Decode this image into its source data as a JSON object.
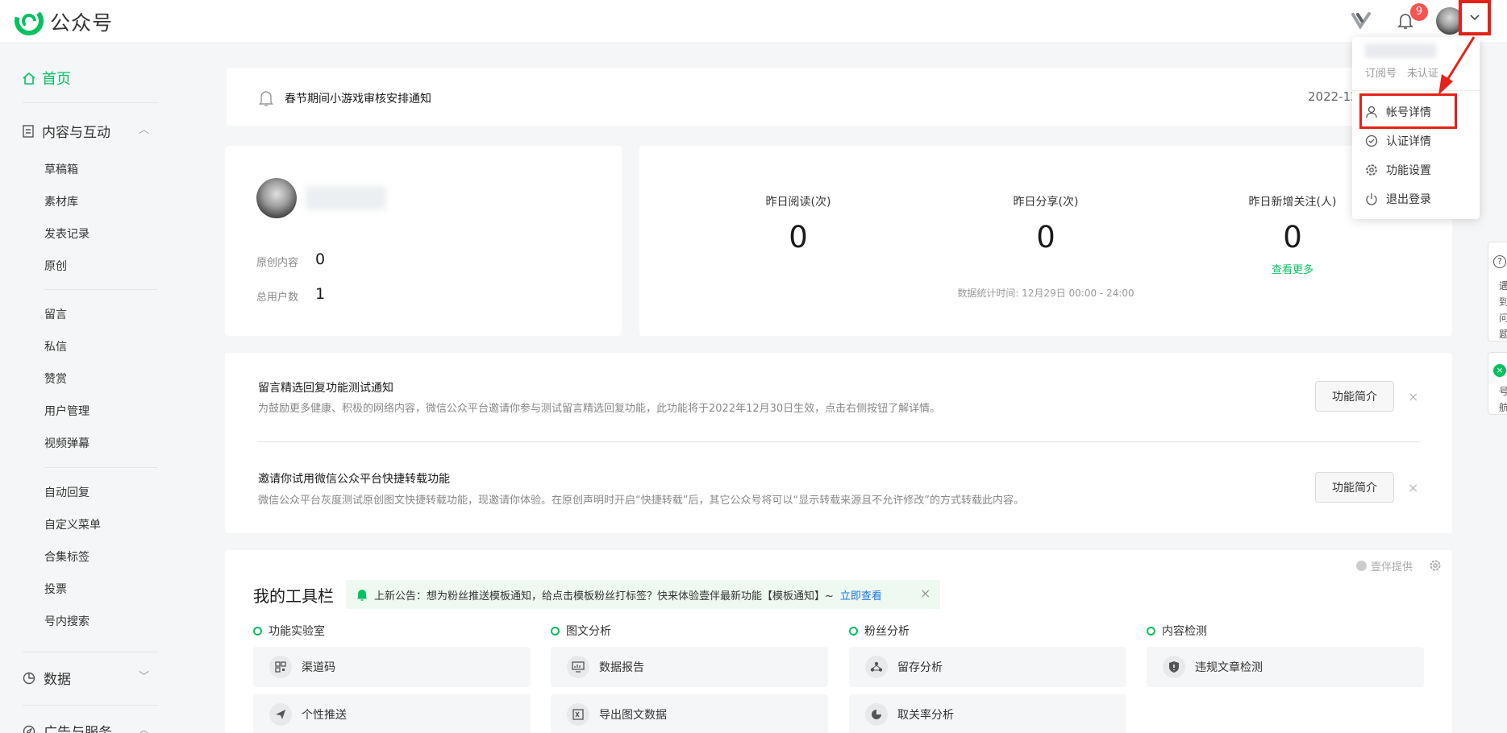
{
  "header": {
    "brand": "公众号",
    "notification_count": "9"
  },
  "sidebar": {
    "home": "首页",
    "content_section": "内容与互动",
    "content_items": [
      "草稿箱",
      "素材库",
      "发表记录",
      "原创"
    ],
    "interaction_items": [
      "留言",
      "私信",
      "赞赏",
      "用户管理",
      "视频弹幕"
    ],
    "tool_items": [
      "自动回复",
      "自定义菜单",
      "合集标签",
      "投票",
      "号内搜索"
    ],
    "data_section": "数据",
    "ads_section": "广告与服务"
  },
  "notice": {
    "text": "春节期间小游戏审核安排通知",
    "date": "2022-12"
  },
  "profile": {
    "original_label": "原创内容",
    "original_value": "0",
    "users_label": "总用户数",
    "users_value": "1"
  },
  "stats": {
    "items": [
      {
        "label": "昨日阅读(次)",
        "value": "0"
      },
      {
        "label": "昨日分享(次)",
        "value": "0"
      },
      {
        "label": "昨日新增关注(人)",
        "value": "0"
      }
    ],
    "more_link": "查看更多",
    "stat_time": "数据统计时间: 12月29日 00:00 - 24:00"
  },
  "notices": [
    {
      "title": "留言精选回复功能测试通知",
      "desc": "为鼓励更多健康、积极的网络内容，微信公众平台邀请你参与测试留言精选回复功能，此功能将于2022年12月30日生效，点击右侧按钮了解详情。",
      "button": "功能简介",
      "close": "×"
    },
    {
      "title": "邀请你试用微信公众平台快捷转载功能",
      "desc": "微信公众平台灰度测试原创图文快捷转载功能，现邀请你体验。在原创声明时开启“快捷转载”后，其它公众号将可以“显示转载来源且不允许修改”的方式转载此内容。",
      "button": "功能简介",
      "close": "×"
    }
  ],
  "toolbar": {
    "title": "我的工具栏",
    "provider": "壹伴提供",
    "announcement": "上新公告：想为粉丝推送模板通知，给点击模板粉丝打标签？快来体验壹伴最新功能【模板通知】~",
    "announcement_link": "立即查看",
    "announcement_close": "×",
    "categories": [
      {
        "name": "功能实验室",
        "tools": [
          "渠道码",
          "个性推送"
        ]
      },
      {
        "name": "图文分析",
        "tools": [
          "数据报告",
          "导出图文数据"
        ]
      },
      {
        "name": "粉丝分析",
        "tools": [
          "留存分析",
          "取关率分析"
        ]
      },
      {
        "name": "内容检测",
        "tools": [
          "违规文章检测"
        ]
      }
    ]
  },
  "account_menu": {
    "type": "订阅号",
    "status": "未认证",
    "items": [
      "帐号详情",
      "认证详情",
      "功能设置",
      "退出登录"
    ]
  },
  "right_tabs": {
    "help_text": "遇到问题",
    "help2_text": "号航"
  },
  "colors": {
    "accent": "#07c160",
    "highlight": "#e62117",
    "badge": "#fa5151",
    "link": "#1a73e8"
  }
}
